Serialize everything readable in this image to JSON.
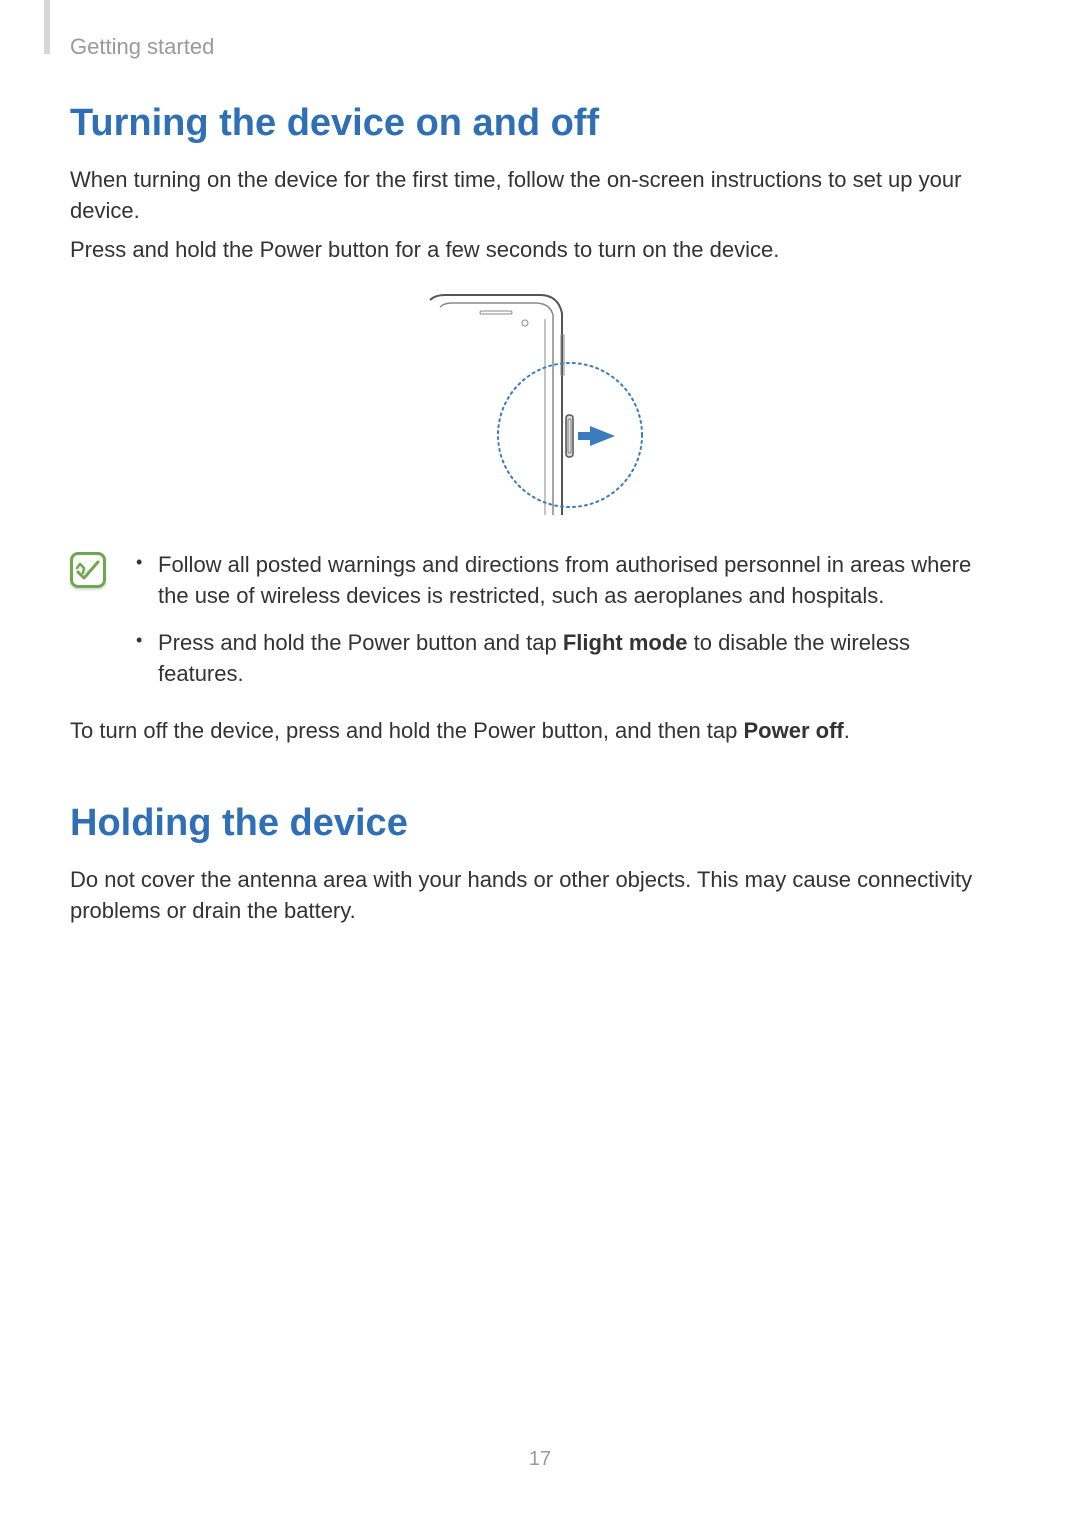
{
  "header": {
    "section_label": "Getting started"
  },
  "section1": {
    "heading": "Turning the device on and off",
    "p1": "When turning on the device for the first time, follow the on-screen instructions to set up your device.",
    "p2": "Press and hold the Power button for a few seconds to turn on the device.",
    "note": {
      "item1": "Follow all posted warnings and directions from authorised personnel in areas where the use of wireless devices is restricted, such as aeroplanes and hospitals.",
      "item2_pre": "Press and hold the Power button and tap ",
      "item2_bold": "Flight mode",
      "item2_post": " to disable the wireless features."
    },
    "p3_pre": "To turn off the device, press and hold the Power button, and then tap ",
    "p3_bold": "Power off",
    "p3_post": "."
  },
  "section2": {
    "heading": "Holding the device",
    "p1": "Do not cover the antenna area with your hands or other objects. This may cause connectivity problems or drain the battery."
  },
  "page_number": "17"
}
